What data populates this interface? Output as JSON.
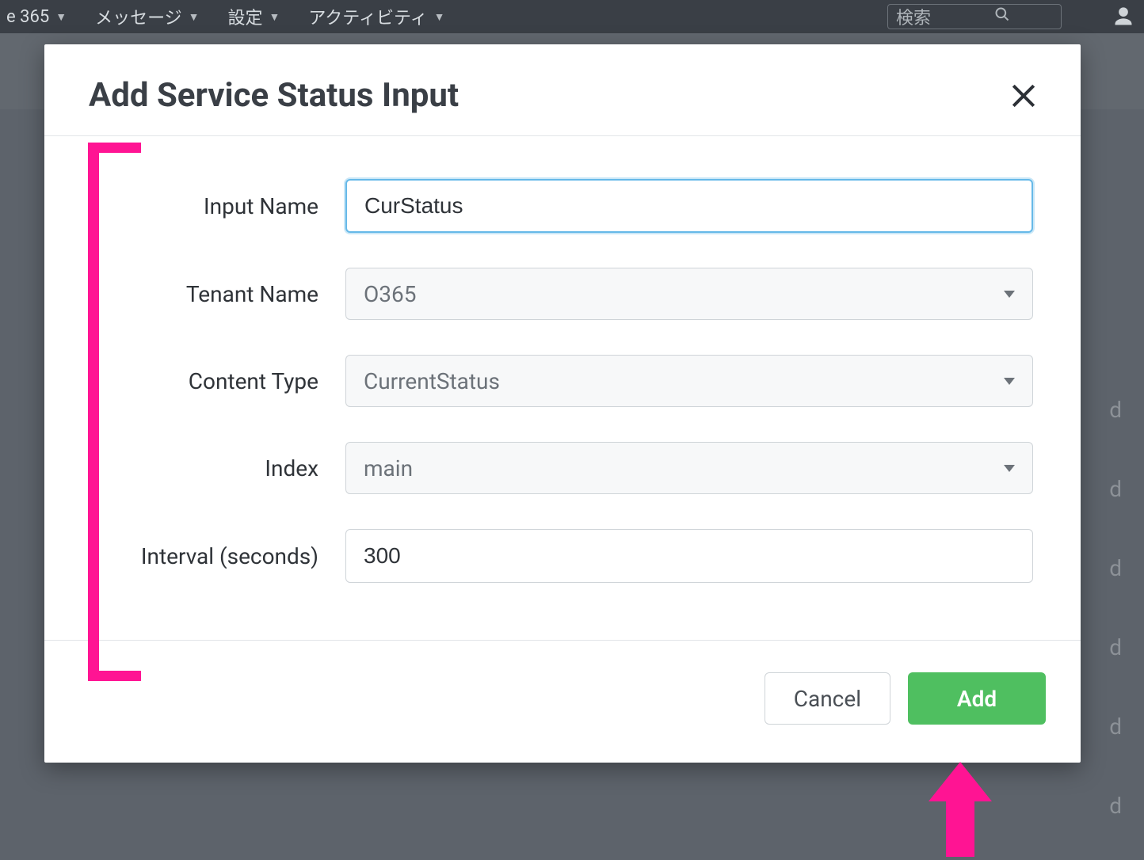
{
  "nav": {
    "items": [
      {
        "label": "e 365"
      },
      {
        "label": "メッセージ"
      },
      {
        "label": "設定"
      },
      {
        "label": "アクティビティ"
      }
    ],
    "search_placeholder": "検索"
  },
  "background_rows": [
    "d",
    "d",
    "d",
    "d",
    "d",
    "d"
  ],
  "modal": {
    "title": "Add Service Status Input",
    "fields": {
      "input_name": {
        "label": "Input Name",
        "value": "CurStatus"
      },
      "tenant_name": {
        "label": "Tenant Name",
        "value": "O365"
      },
      "content_type": {
        "label": "Content Type",
        "value": "CurrentStatus"
      },
      "index": {
        "label": "Index",
        "value": "main"
      },
      "interval": {
        "label": "Interval (seconds)",
        "value": "300"
      }
    },
    "buttons": {
      "cancel": "Cancel",
      "add": "Add"
    }
  },
  "annotation": {
    "color": "#ff1493"
  }
}
